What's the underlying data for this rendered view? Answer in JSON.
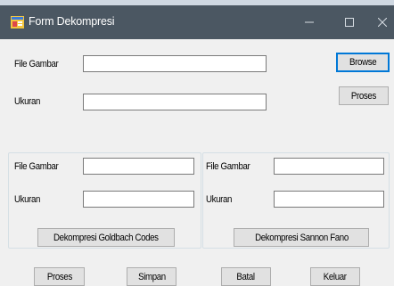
{
  "window": {
    "title": "Form Dekompresi",
    "minimize_symbol": "–",
    "maximize_symbol": "☐",
    "close_symbol": "X"
  },
  "top_section": {
    "file_label": "File Gambar",
    "file_value": "",
    "size_label": "Ukuran",
    "size_value": "",
    "browse_label": "Browse",
    "proses_label": "Proses"
  },
  "left_group": {
    "file_label": "File Gambar",
    "file_value": "",
    "size_label": "Ukuran",
    "size_value": "",
    "action_label": "Dekompresi Goldbach Codes"
  },
  "right_group": {
    "file_label": "File Gambar",
    "file_value": "",
    "size_label": "Ukuran",
    "size_value": "",
    "action_label": "Dekompresi Sannon Fano"
  },
  "bottom_buttons": {
    "proses": "Proses",
    "simpan": "Simpan",
    "batal": "Batal",
    "keluar": "Keluar"
  },
  "colors": {
    "titlebar": "#4b5762",
    "client": "#f0f0f0",
    "default_button_border": "#0078d7"
  }
}
